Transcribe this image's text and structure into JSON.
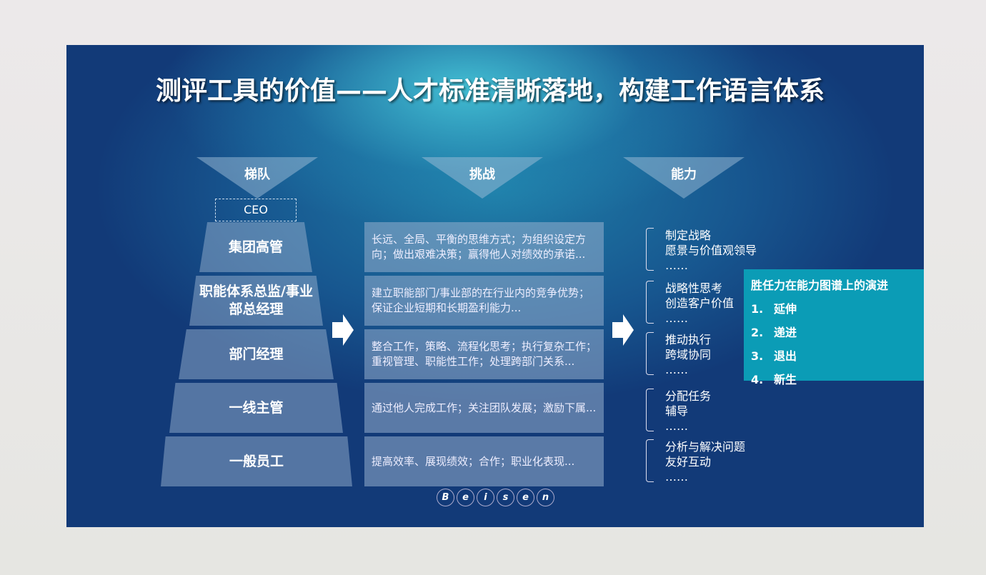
{
  "title": "测评工具的价值——人才标准清晰落地，构建工作语言体系",
  "headers": [
    "梯队",
    "挑战",
    "能力"
  ],
  "ceo": "CEO",
  "levels": [
    "集团高管",
    "职能体系总监/事业部总经理",
    "部门经理",
    "一线主管",
    "一般员工"
  ],
  "challenges": [
    "长远、全局、平衡的思维方式；为组织设定方向；做出艰难决策；赢得他人对绩效的承诺...",
    "建立职能部门/事业部的在行业内的竞争优势；保证企业短期和长期盈利能力...",
    "整合工作，策略、流程化思考；执行复杂工作；重视管理、职能性工作；处理跨部门关系...",
    "通过他人完成工作；关注团队发展；激励下属...",
    "提高效率、展现绩效；合作；职业化表现..."
  ],
  "abilities": [
    [
      "制定战略",
      "愿景与价值观领导",
      "……"
    ],
    [
      "战略性思考",
      "创造客户价值",
      "……"
    ],
    [
      "推动执行",
      "跨域协同",
      "……"
    ],
    [
      "分配任务",
      "辅导",
      "……"
    ],
    [
      "分析与解决问题",
      "友好互动",
      "……"
    ]
  ],
  "evolution": {
    "title": "胜任力在能力图谱上的演进",
    "items": [
      {
        "n": "1.",
        "t": "延伸"
      },
      {
        "n": "2.",
        "t": "递进"
      },
      {
        "n": "3.",
        "t": "退出"
      },
      {
        "n": "4.",
        "t": "新生"
      }
    ]
  },
  "logo": [
    "B",
    "e",
    "i",
    "s",
    "e",
    "n"
  ],
  "colors": {
    "teal": "#0b9cb6"
  }
}
